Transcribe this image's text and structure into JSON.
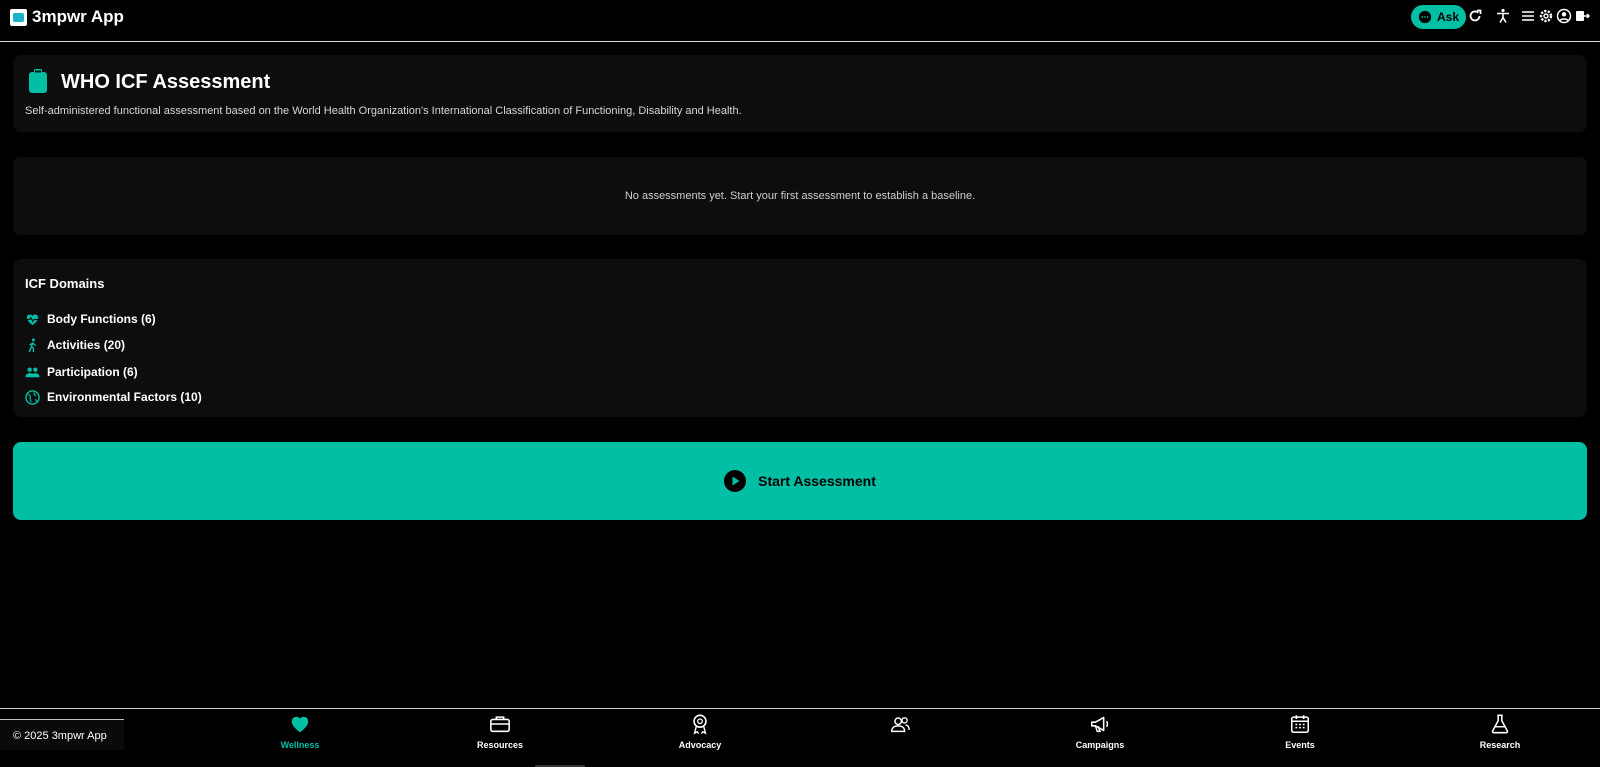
{
  "app": {
    "title": "3mpwr App"
  },
  "topbar": {
    "ask_label": "Ask"
  },
  "header": {
    "title": "WHO ICF Assessment",
    "description": "Self-administered functional assessment based on the World Health Organization's International Classification of Functioning, Disability and Health."
  },
  "empty_state": {
    "message": "No assessments yet. Start your first assessment to establish a baseline."
  },
  "domains": {
    "title": "ICF Domains",
    "items": [
      {
        "label": "Body Functions (6)",
        "icon": "heart-pulse-icon"
      },
      {
        "label": "Activities (20)",
        "icon": "walking-person-icon"
      },
      {
        "label": "Participation (6)",
        "icon": "people-icon"
      },
      {
        "label": "Environmental Factors (10)",
        "icon": "globe-icon"
      }
    ]
  },
  "start_button": {
    "label": "Start Assessment"
  },
  "footer": {
    "copyright": "© 2025 3mpwr App",
    "nav": [
      {
        "label": "Wellness",
        "icon": "heart-icon",
        "active": true
      },
      {
        "label": "Resources",
        "icon": "briefcase-icon"
      },
      {
        "label": "Advocacy",
        "icon": "award-icon"
      },
      {
        "label": "",
        "icon": "community-icon"
      },
      {
        "label": "Campaigns",
        "icon": "megaphone-icon"
      },
      {
        "label": "Events",
        "icon": "calendar-icon"
      },
      {
        "label": "Research",
        "icon": "flask-icon"
      }
    ]
  },
  "colors": {
    "accent": "#00bfa5",
    "background": "#000000",
    "card": "#0d0d0d"
  }
}
